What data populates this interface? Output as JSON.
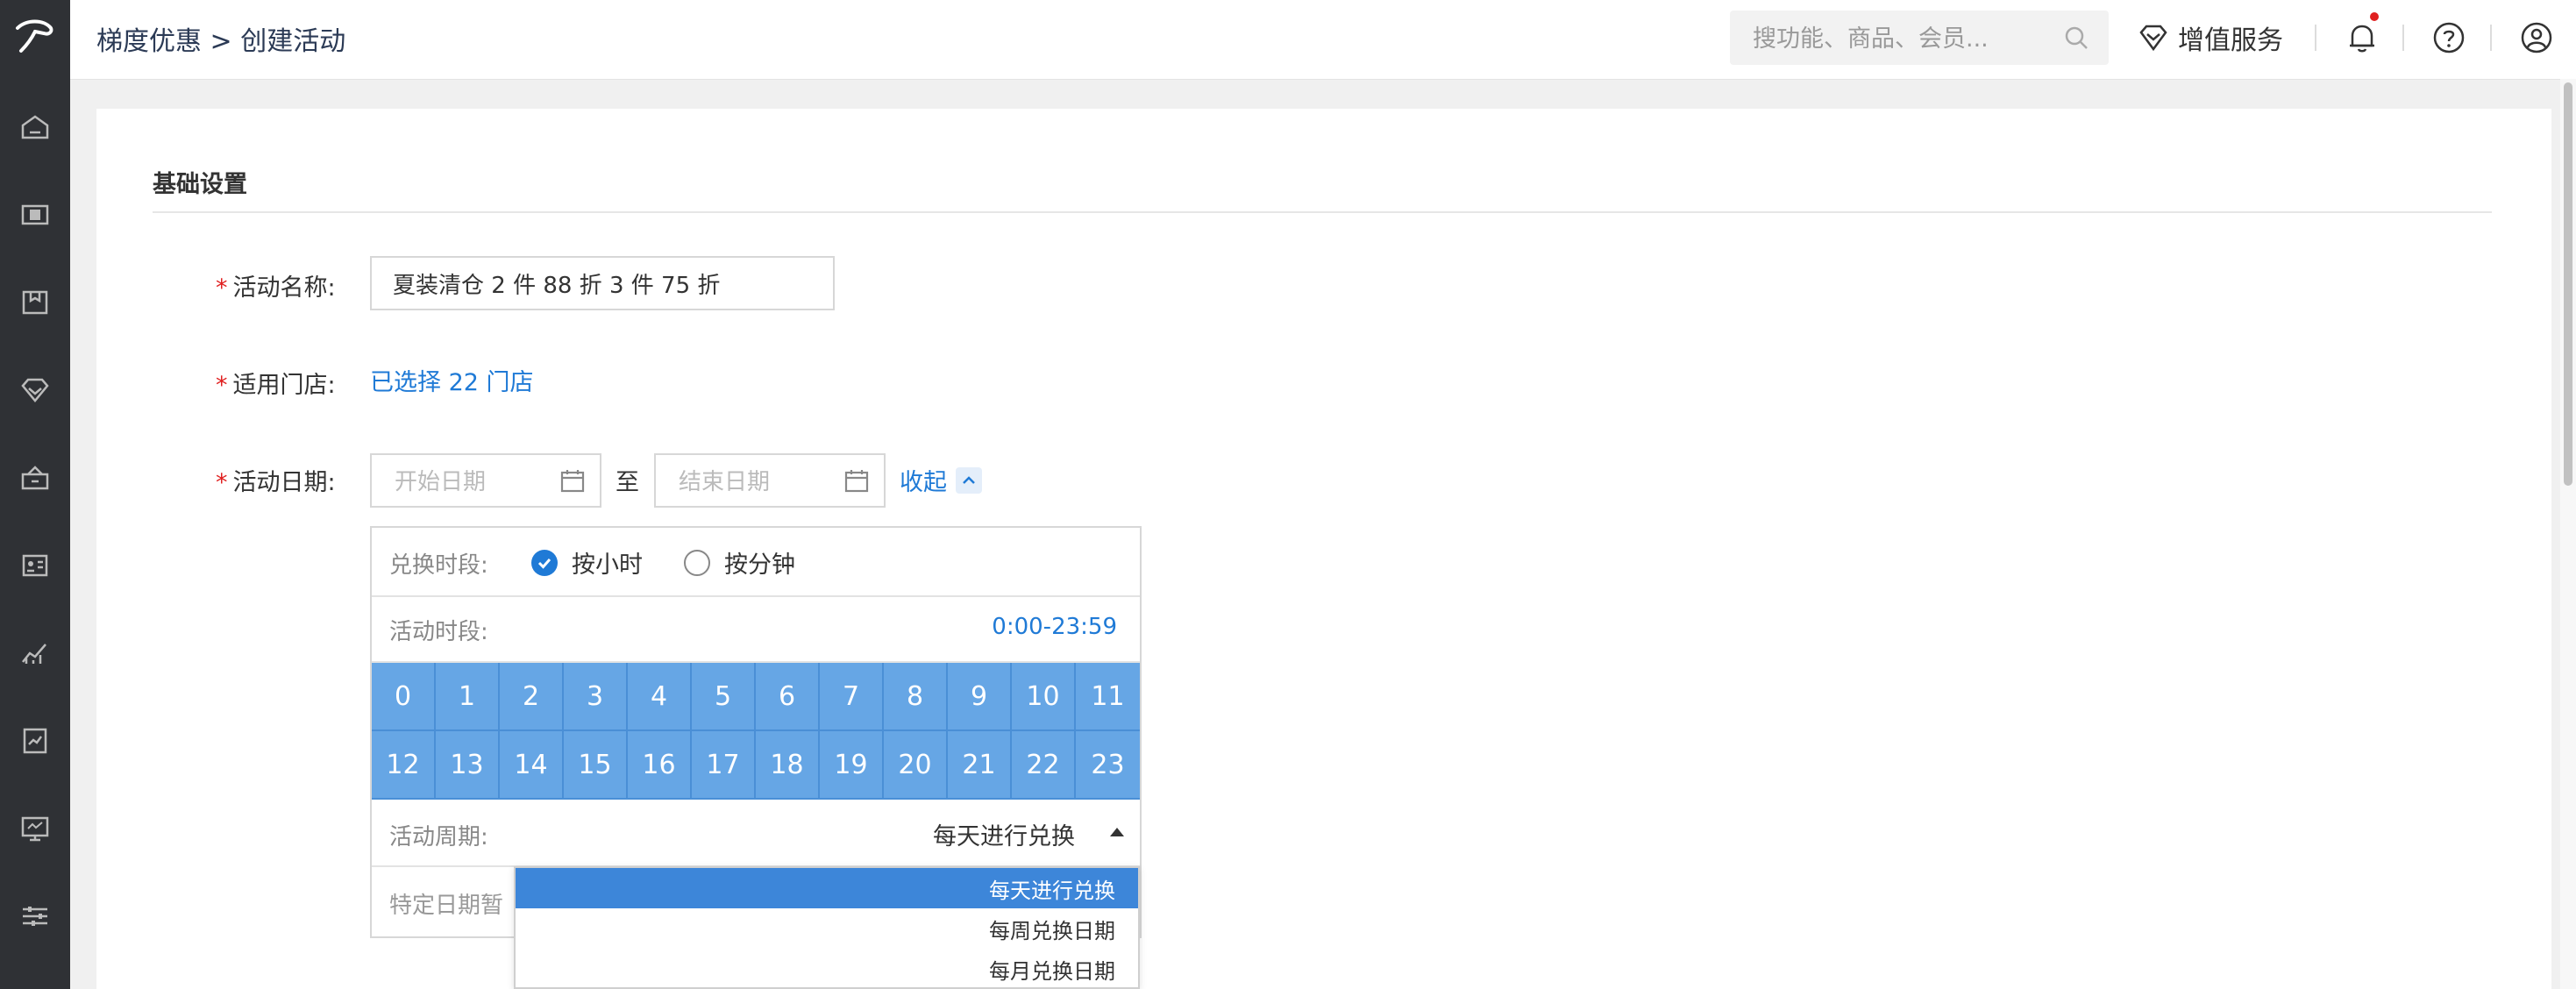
{
  "breadcrumb": {
    "root": "梯度优惠",
    "separator": ">",
    "current": "创建活动"
  },
  "search": {
    "placeholder": "搜功能、商品、会员..."
  },
  "header": {
    "value_added_label": "增值服务"
  },
  "sidebar": {
    "items": [
      "home-icon",
      "cashier-icon",
      "goods-icon",
      "member-icon",
      "marketing-icon",
      "contacts-icon",
      "analytics-icon",
      "reports-icon",
      "monitor-icon",
      "settings-icon"
    ]
  },
  "section": {
    "title": "基础设置"
  },
  "form": {
    "name_label": "活动名称:",
    "name_value": "夏装清仓 2 件 88 折 3 件 75 折",
    "store_label": "适用门店:",
    "store_link": "已选择 22 门店",
    "date_label": "活动日期:",
    "start_placeholder": "开始日期",
    "end_placeholder": "结束日期",
    "to_text": "至",
    "collapse_label": "收起",
    "required_mark": "*"
  },
  "panel": {
    "period_label": "兑换时段:",
    "option_hour": "按小时",
    "option_minute": "按分钟",
    "selected_option": "按小时",
    "time_label": "活动时段:",
    "time_range": "0:00-23:59",
    "hours_row1": [
      "0",
      "1",
      "2",
      "3",
      "4",
      "5",
      "6",
      "7",
      "8",
      "9",
      "10",
      "11"
    ],
    "hours_row2": [
      "12",
      "13",
      "14",
      "15",
      "16",
      "17",
      "18",
      "19",
      "20",
      "21",
      "22",
      "23"
    ],
    "cycle_label": "活动周期:",
    "cycle_value": "每天进行兑换",
    "special_date_text": "特定日期暂"
  },
  "dropdown": {
    "options": [
      "每天进行兑换",
      "每周兑换日期",
      "每月兑换日期"
    ],
    "selected": "每天进行兑换"
  },
  "colors": {
    "accent": "#1f7ad6",
    "hour_cell": "#66a6e5",
    "sidebar": "#2f3135",
    "required": "#e02020"
  }
}
